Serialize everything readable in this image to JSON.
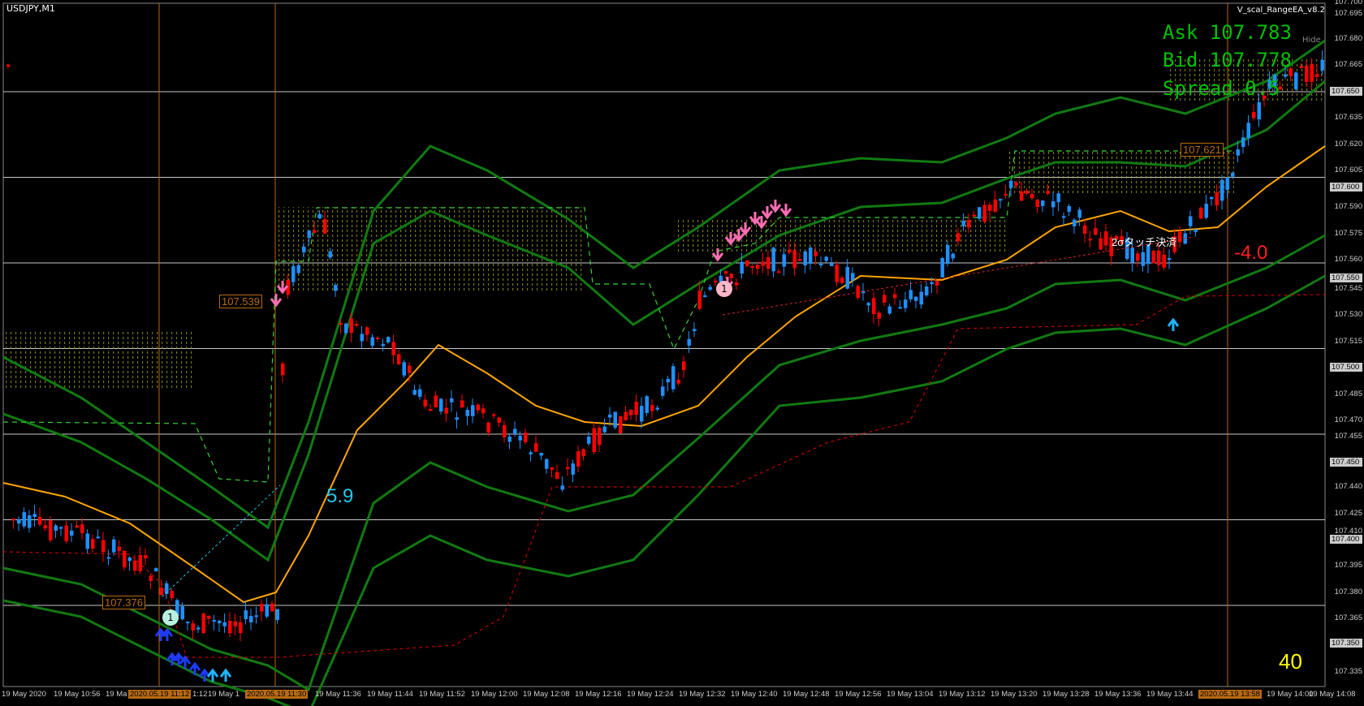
{
  "window_title": "USDJPY,M1",
  "ea_name": "V_scal_RangeEA_v8.2",
  "hide_label": "Hide",
  "quote": {
    "ask": "Ask 107.783",
    "bid": "Bid 107.778",
    "spread": "Spread 0.5"
  },
  "labels": {
    "pips_left": "5.9",
    "pips_right": "-4.0",
    "counter": "40",
    "price_tag_1": "107.539",
    "price_tag_2": "107.376",
    "price_tag_3": "107.621",
    "touch_note": "2σタッチ決済",
    "marker_1": "1",
    "marker_2": "1"
  },
  "price_axis": [
    "107.700",
    "107.695",
    "107.680",
    "107.665",
    "107.650",
    "107.635",
    "107.620",
    "107.605",
    "107.600",
    "107.590",
    "107.575",
    "107.560",
    "107.550",
    "107.545",
    "107.530",
    "107.515",
    "107.500",
    "107.485",
    "107.470",
    "107.455",
    "107.450",
    "107.440",
    "107.425",
    "107.410",
    "107.400",
    "107.395",
    "107.380",
    "107.365",
    "107.350",
    "107.335"
  ],
  "time_axis": [
    "19 May 2020",
    "19 May 10:56",
    "19 Ma",
    "2020.05.19 11:12",
    "1:12",
    "19 May 1",
    "2020.05.19 11:30",
    "19 May 11:36",
    "19 May 11:44",
    "19 May 11:52",
    "19 May 12:00",
    "19 May 12:08",
    "19 May 12:16",
    "19 May 12:24",
    "19 May 12:32",
    "19 May 12:40",
    "19 May 12:48",
    "19 May 12:56",
    "19 May 13:04",
    "19 May 13:12",
    "19 May 13:20",
    "19 May 13:28",
    "19 May 13:36",
    "19 May 13:44",
    "2020.05.19 13:58",
    "19 May 14:00",
    "19 May 14:08"
  ],
  "colors": {
    "background": "#000000",
    "bull": "#1e90ff",
    "bear": "#ff0000",
    "ma": "#ffa500",
    "band": "#117a11",
    "ask_text": "#00c000",
    "level_line": "#c8c8c8",
    "vline": "#b86a10"
  }
}
